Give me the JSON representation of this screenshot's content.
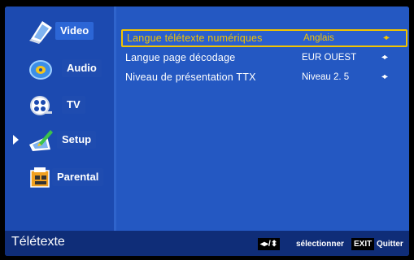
{
  "sidebar": {
    "items": [
      {
        "label": "Video",
        "icon": "video-icon",
        "active": true
      },
      {
        "label": "Audio",
        "icon": "audio-icon",
        "active": false
      },
      {
        "label": "TV",
        "icon": "tv-icon",
        "active": false
      },
      {
        "label": "Setup",
        "icon": "setup-icon",
        "active": false
      },
      {
        "label": "Parental",
        "icon": "parental-icon",
        "active": false
      }
    ]
  },
  "settings": [
    {
      "name": "Langue télétexte numériques",
      "value": "Anglais"
    },
    {
      "name": "Langue page décodage",
      "value": "EUR OUEST"
    },
    {
      "name": "Niveau de présentation TTX",
      "value": "Niveau 2. 5"
    }
  ],
  "footer": {
    "title": "Télétexte",
    "nav_keys": "◂▸/⬍",
    "select_label": "sélectionner",
    "exit_key": "EXIT",
    "quit_label": "Quitter"
  },
  "colors": {
    "highlight": "#f2c400",
    "background": "#1e4fb8"
  }
}
